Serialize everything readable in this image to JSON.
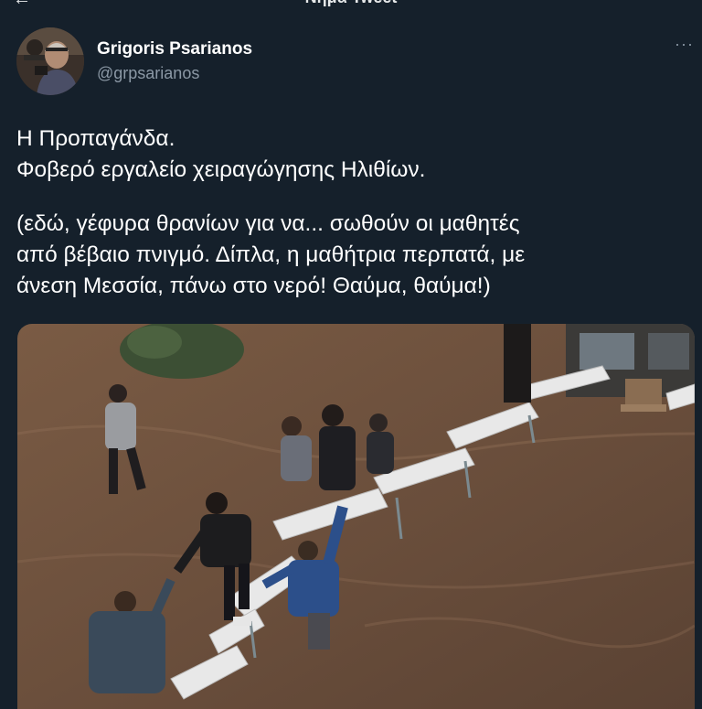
{
  "header": {
    "title": "Νήμα Tweet"
  },
  "author": {
    "name": "Grigoris Psarianos",
    "handle": "@grpsarianos"
  },
  "tweet": {
    "line1": "Η Προπαγάνδα.",
    "line2": "Φοβερό εργαλείο χειραγώγησης Ηλιθίων.",
    "line3": "(εδώ, γέφυρα θρανίων για να... σωθούν οι μαθητές",
    "line4": "από βέβαιο πνιγμό. Δίπλα, η μαθήτρια περπατά, με",
    "line5": "άνεση Μεσσία, πάνω στο νερό! Θαύμα, θαύμα!)"
  },
  "colors": {
    "background": "#15202b",
    "text_primary": "#ffffff",
    "text_secondary": "#8b98a5",
    "water": "#6b4f3c"
  },
  "icons": {
    "back": "arrow-left-icon",
    "more": "more-horizontal-icon"
  }
}
